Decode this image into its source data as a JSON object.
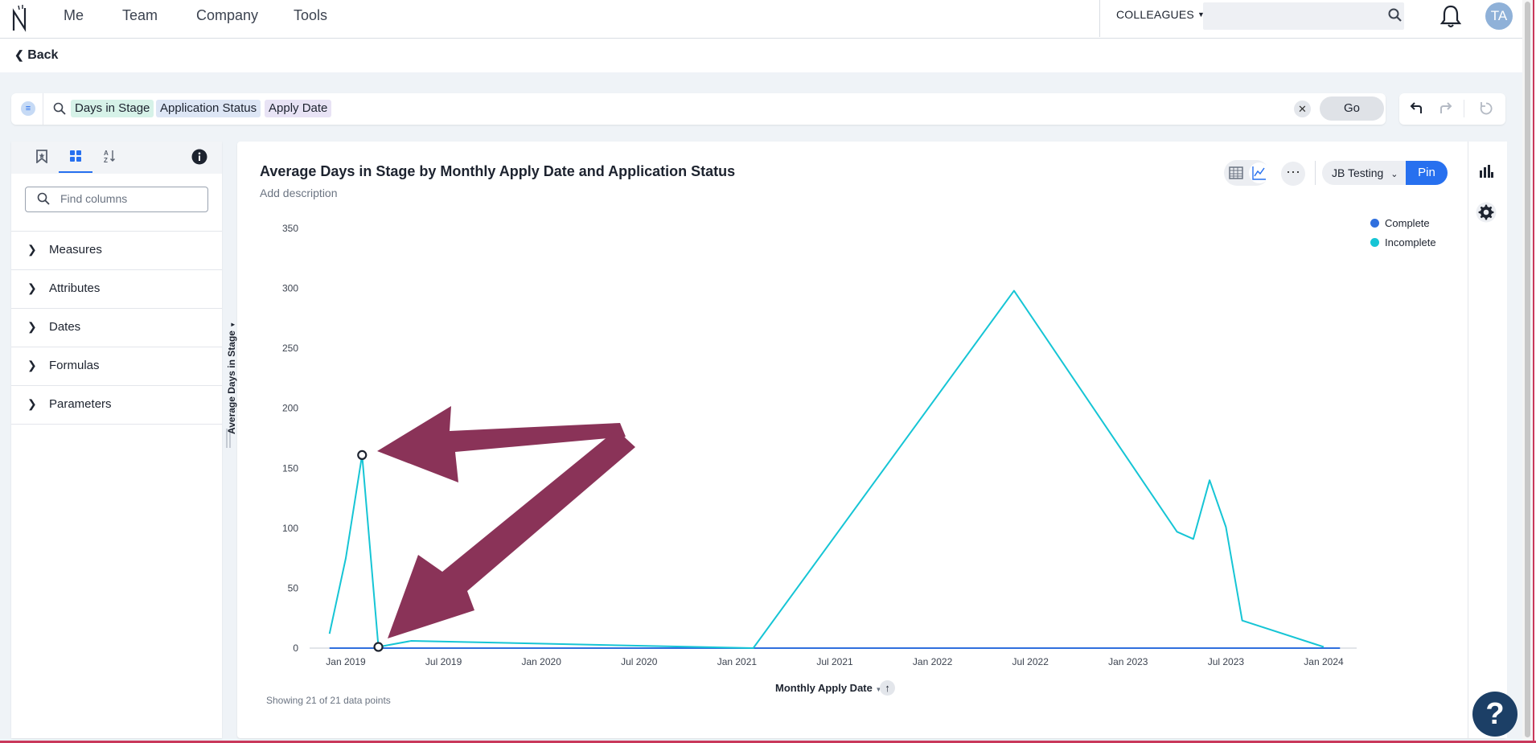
{
  "nav": {
    "items": [
      "Me",
      "Team",
      "Company",
      "Tools"
    ],
    "colleagues": "COLLEAGUES",
    "avatar_initials": "TA"
  },
  "back_label": "Back",
  "query": {
    "chips": [
      "Days in Stage",
      "Application Status",
      "Apply Date"
    ],
    "go_label": "Go"
  },
  "left_panel": {
    "find_placeholder": "Find columns",
    "sections": [
      "Measures",
      "Attributes",
      "Dates",
      "Formulas",
      "Parameters"
    ]
  },
  "card": {
    "title": "Average Days in Stage by Monthly Apply Date and Application Status",
    "description": "Add description",
    "worksheet_label": "JB Testing",
    "pin_label": "Pin",
    "showing": "Showing 21 of 21 data points"
  },
  "colors": {
    "accent": "#2770ef",
    "complete": "#2f6fde",
    "incomplete": "#16c5d5",
    "annotation_arrow": "#8a3358"
  },
  "chart_data": {
    "type": "line",
    "title": "Average Days in Stage by Monthly Apply Date and Application Status",
    "xlabel": "Monthly Apply Date",
    "ylabel": "Average Days in Stage",
    "ylim": [
      0,
      350
    ],
    "y_ticks": [
      0,
      50,
      100,
      150,
      200,
      250,
      300,
      350
    ],
    "x_ticks": [
      "Jan 2019",
      "Jul 2019",
      "Jan 2020",
      "Jul 2020",
      "Jan 2021",
      "Jul 2021",
      "Jan 2022",
      "Jul 2022",
      "Jan 2023",
      "Jul 2023",
      "Jan 2024"
    ],
    "x_range": [
      "2018-12",
      "2024-02"
    ],
    "legend_position": "top-right",
    "series": [
      {
        "name": "Complete",
        "color": "#2f6fde",
        "points": [
          {
            "x": "2018-12",
            "y": 0
          },
          {
            "x": "2024-02",
            "y": 0
          }
        ]
      },
      {
        "name": "Incomplete",
        "color": "#16c5d5",
        "points": [
          {
            "x": "2018-12",
            "y": 12
          },
          {
            "x": "2019-01",
            "y": 75
          },
          {
            "x": "2019-02",
            "y": 161
          },
          {
            "x": "2019-03",
            "y": 1
          },
          {
            "x": "2019-05",
            "y": 6
          },
          {
            "x": "2021-02",
            "y": 0
          },
          {
            "x": "2022-06",
            "y": 298
          },
          {
            "x": "2023-04",
            "y": 97
          },
          {
            "x": "2023-05",
            "y": 91
          },
          {
            "x": "2023-06",
            "y": 140
          },
          {
            "x": "2023-07",
            "y": 101
          },
          {
            "x": "2023-08",
            "y": 23
          },
          {
            "x": "2024-01",
            "y": 1
          }
        ]
      }
    ],
    "highlighted_points": [
      {
        "x": "2019-02",
        "y": 161
      },
      {
        "x": "2019-03",
        "y": 1
      }
    ]
  }
}
